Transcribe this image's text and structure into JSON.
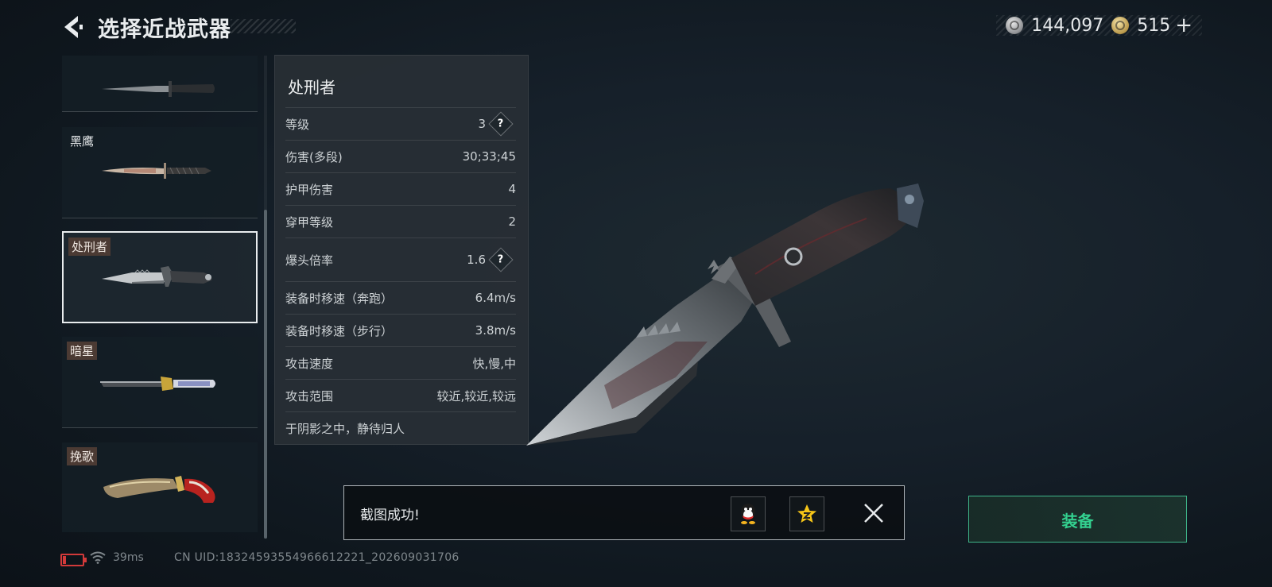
{
  "header": {
    "title": "选择近战武器",
    "silver_amount": "144,097",
    "gold_amount": "515",
    "plus_label": "+"
  },
  "weapon_list": [
    {
      "name": ""
    },
    {
      "name": "黑鹰"
    },
    {
      "name": "处刑者",
      "selected": true
    },
    {
      "name": "暗星"
    },
    {
      "name": "挽歌"
    }
  ],
  "detail": {
    "name": "处刑者",
    "stats": [
      {
        "label": "等级",
        "value": "3",
        "help": true
      },
      {
        "label": "伤害(多段)",
        "value": "30;33;45"
      },
      {
        "label": "护甲伤害",
        "value": "4"
      },
      {
        "label": "穿甲等级",
        "value": "2"
      },
      {
        "label": "爆头倍率",
        "value": "1.6",
        "help": true
      },
      {
        "label": "装备时移速（奔跑）",
        "value": "6.4m/s"
      },
      {
        "label": "装备时移速（步行）",
        "value": "3.8m/s"
      },
      {
        "label": "攻击速度",
        "value": "快,慢,中"
      },
      {
        "label": "攻击范围",
        "value": "较近,较近,较远"
      }
    ],
    "description": "于阴影之中，静待归人",
    "help_symbol": "?"
  },
  "toast": {
    "message": "截图成功!",
    "share_icons": [
      "qq-icon",
      "qzone-icon"
    ]
  },
  "equip_button": {
    "label": "装备",
    "color": "#33d08f"
  },
  "footer": {
    "ping": "39ms",
    "uid": "CN UID:18324593554966612221_202609031706"
  }
}
